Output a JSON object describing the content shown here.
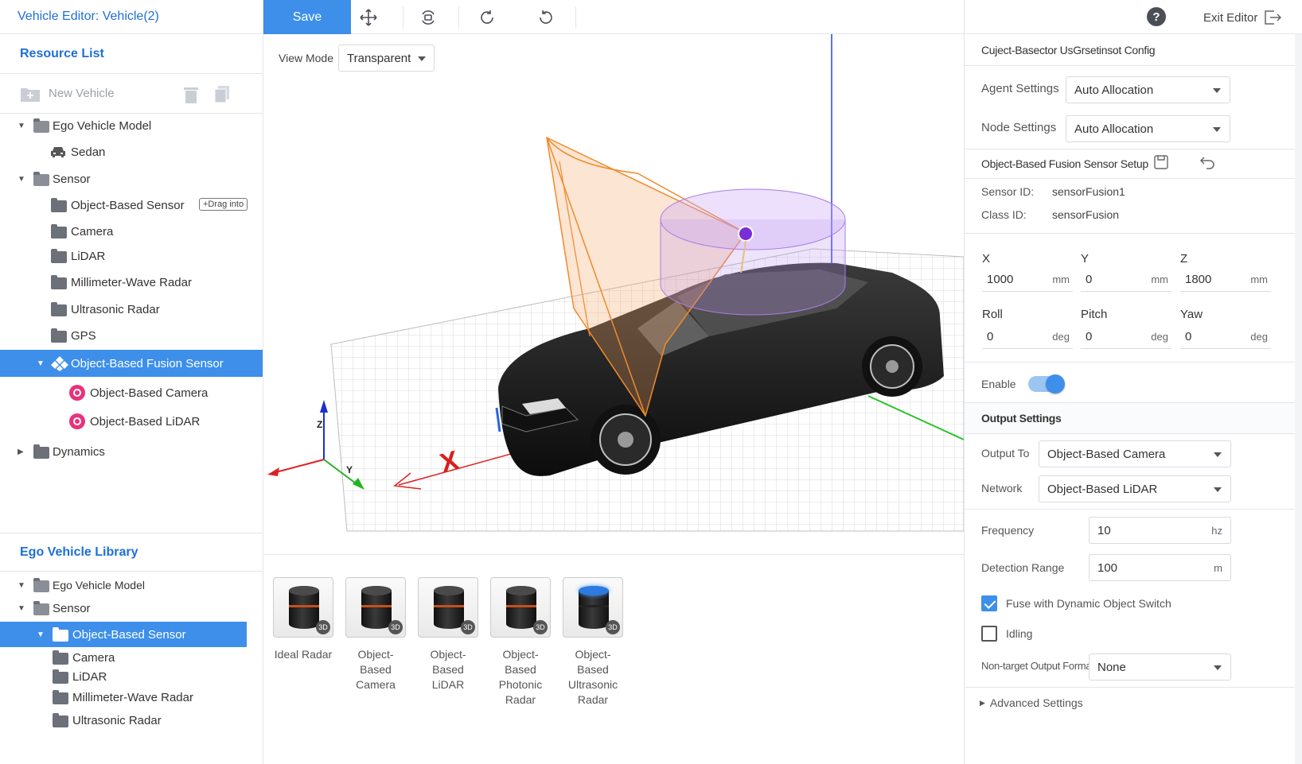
{
  "window": {
    "title": "Vehicle Editor: Vehicle(2)"
  },
  "toolbar": {
    "save_label": "Save"
  },
  "resource_list": {
    "title": "Resource List",
    "new_vehicle_label": "New Vehicle",
    "items": [
      {
        "label": "Ego Vehicle Model"
      },
      {
        "label": "Sedan"
      },
      {
        "label": "Sensor"
      },
      {
        "label": "Object-Based Sensor",
        "tag": "+Drag into"
      },
      {
        "label": "Camera"
      },
      {
        "label": "LiDAR"
      },
      {
        "label": "Millimeter-Wave Radar"
      },
      {
        "label": "Ultrasonic Radar"
      },
      {
        "label": "GPS"
      },
      {
        "label": "Object-Based Fusion Sensor"
      },
      {
        "label": "Object-Based Camera"
      },
      {
        "label": "Object-Based LiDAR"
      },
      {
        "label": "Dynamics"
      }
    ]
  },
  "library": {
    "title": "Ego Vehicle Library",
    "items": [
      {
        "label": "Ego Vehicle Model"
      },
      {
        "label": "Sensor"
      },
      {
        "label": "Object-Based Sensor"
      },
      {
        "label": "Camera"
      },
      {
        "label": "LiDAR"
      },
      {
        "label": "Millimeter-Wave Radar"
      },
      {
        "label": "Ultrasonic Radar"
      }
    ]
  },
  "viewport": {
    "view_mode_label": "View Mode",
    "view_mode_value": "Transparent",
    "axis_labels": {
      "x": "X",
      "y": "Y",
      "z": "Z"
    }
  },
  "gallery": {
    "badge": "3D",
    "items": [
      {
        "line1": "Ideal Radar",
        "line2": "",
        "line3": ""
      },
      {
        "line1": "Object-Based",
        "line2": "Camera",
        "line3": ""
      },
      {
        "line1": "Object-Based",
        "line2": "LiDAR",
        "line3": ""
      },
      {
        "line1": "Object-Based",
        "line2": "Photonic",
        "line3": "Radar"
      },
      {
        "line1": "Object-Based",
        "line2": "Ultrasonic",
        "line3": "Radar"
      }
    ]
  },
  "right_panel": {
    "exit_label": "Exit Editor",
    "help_glyph": "?",
    "config_title": "Cuject-Basector UsGrsetinsot Config",
    "agent_settings_label": "Agent Settings",
    "agent_settings_value": "Auto Allocation",
    "node_settings_label": "Node Settings",
    "node_settings_value": "Auto Allocation",
    "setup_title": "Object-Based Fusion Sensor Setup",
    "sensor_id_label": "Sensor ID:",
    "sensor_id_value": "sensorFusion1",
    "class_id_label": "Class ID:",
    "class_id_value": "sensorFusion",
    "position": {
      "x_label": "X",
      "x_value": "1000",
      "y_label": "Y",
      "y_value": "0",
      "z_label": "Z",
      "z_value": "1800",
      "unit": "mm"
    },
    "rotation": {
      "roll_label": "Roll",
      "roll_value": "0",
      "pitch_label": "Pitch",
      "pitch_value": "0",
      "yaw_label": "Yaw",
      "yaw_value": "0",
      "unit": "deg"
    },
    "enable_label": "Enable",
    "enable_on": true,
    "output_settings_title": "Output Settings",
    "output_to_label": "Output To",
    "output_to_value": "Object-Based Camera",
    "network_label": "Network",
    "network_value": "Object-Based LiDAR",
    "frequency_label": "Frequency",
    "frequency_value": "10",
    "frequency_unit": "hz",
    "detection_range_label": "Detection Range",
    "detection_range_value": "100",
    "detection_range_unit": "m",
    "fuse_label": "Fuse with Dynamic Object Switch",
    "fuse_checked": true,
    "idling_label": "Idling",
    "idling_checked": false,
    "non_target_label": "Non-target Output Format",
    "non_target_value": "None",
    "advanced_label": "Advanced Settings"
  },
  "colors": {
    "accent": "#3d8fea",
    "title_blue": "#1e6fd9",
    "pink": "#e8327a",
    "frustum": "#f5a35c",
    "cylinder": "#b98ef0"
  }
}
